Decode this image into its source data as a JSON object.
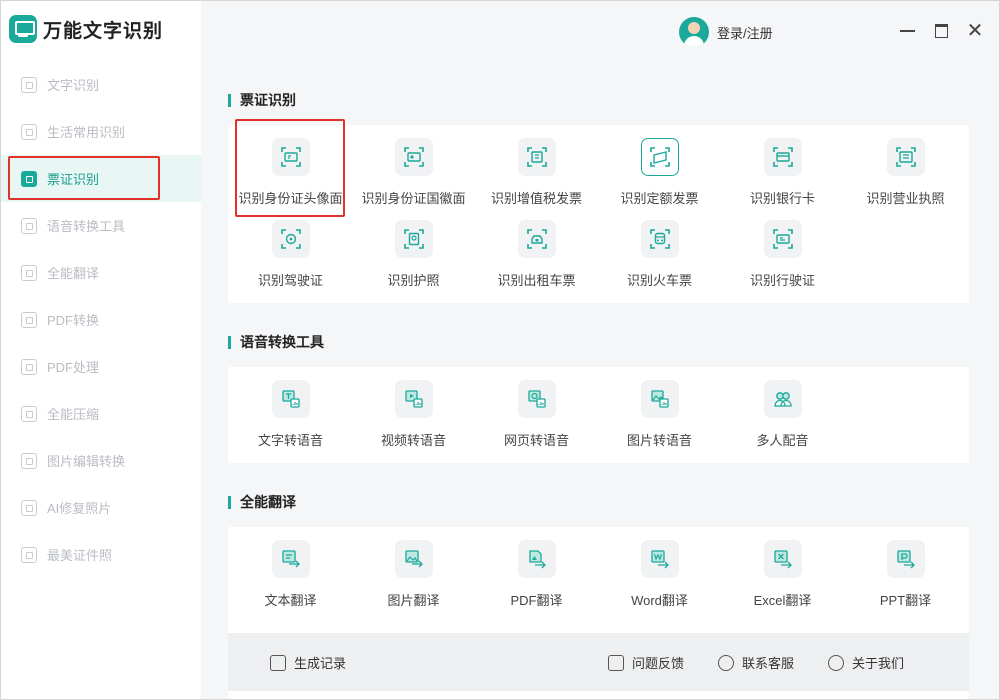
{
  "app": {
    "title": "万能文字识别"
  },
  "user": {
    "login_label": "登录/注册"
  },
  "sidebar": {
    "items": [
      {
        "label": "文字识别",
        "icon": "text-scan-icon",
        "active": false
      },
      {
        "label": "生活常用识别",
        "icon": "life-scan-icon",
        "active": false
      },
      {
        "label": "票证识别",
        "icon": "ticket-scan-icon",
        "active": true
      },
      {
        "label": "语音转换工具",
        "icon": "voice-icon",
        "active": false
      },
      {
        "label": "全能翻译",
        "icon": "translate-icon",
        "active": false
      },
      {
        "label": "PDF转换",
        "icon": "pdf-convert-icon",
        "active": false
      },
      {
        "label": "PDF处理",
        "icon": "pdf-process-icon",
        "active": false
      },
      {
        "label": "全能压缩",
        "icon": "compress-icon",
        "active": false
      },
      {
        "label": "图片编辑转换",
        "icon": "image-edit-icon",
        "active": false
      },
      {
        "label": "AI修复照片",
        "icon": "ai-repair-icon",
        "active": false
      },
      {
        "label": "最美证件照",
        "icon": "id-photo-icon",
        "active": false
      }
    ]
  },
  "sections": {
    "ticket": {
      "title": "票证识别",
      "tools": [
        {
          "label": "识别身份证头像面",
          "icon": "id-card-front-icon"
        },
        {
          "label": "识别身份证国徽面",
          "icon": "id-card-back-icon"
        },
        {
          "label": "识别增值税发票",
          "icon": "vat-invoice-icon"
        },
        {
          "label": "识别定额发票",
          "icon": "quota-invoice-icon"
        },
        {
          "label": "识别银行卡",
          "icon": "bank-card-icon"
        },
        {
          "label": "识别营业执照",
          "icon": "business-license-icon"
        },
        {
          "label": "识别驾驶证",
          "icon": "driver-license-icon"
        },
        {
          "label": "识别护照",
          "icon": "passport-icon"
        },
        {
          "label": "识别出租车票",
          "icon": "taxi-ticket-icon"
        },
        {
          "label": "识别火车票",
          "icon": "train-ticket-icon"
        },
        {
          "label": "识别行驶证",
          "icon": "vehicle-license-icon"
        }
      ]
    },
    "voice": {
      "title": "语音转换工具",
      "tools": [
        {
          "label": "文字转语音",
          "icon": "text-to-speech-icon"
        },
        {
          "label": "视频转语音",
          "icon": "video-to-speech-icon"
        },
        {
          "label": "网页转语音",
          "icon": "webpage-to-speech-icon"
        },
        {
          "label": "图片转语音",
          "icon": "image-to-speech-icon"
        },
        {
          "label": "多人配音",
          "icon": "multi-voice-icon"
        }
      ]
    },
    "translate": {
      "title": "全能翻译",
      "tools": [
        {
          "label": "文本翻译",
          "icon": "text-translate-icon"
        },
        {
          "label": "图片翻译",
          "icon": "image-translate-icon"
        },
        {
          "label": "PDF翻译",
          "icon": "pdf-translate-icon"
        },
        {
          "label": "Word翻译",
          "icon": "word-translate-icon"
        },
        {
          "label": "Excel翻译",
          "icon": "excel-translate-icon"
        },
        {
          "label": "PPT翻译",
          "icon": "ppt-translate-icon"
        }
      ]
    }
  },
  "bottom": {
    "records": "生成记录",
    "feedback": "问题反馈",
    "support": "联系客服",
    "about": "关于我们"
  },
  "colors": {
    "accent": "#1aa99a",
    "highlight": "#e0312b"
  }
}
